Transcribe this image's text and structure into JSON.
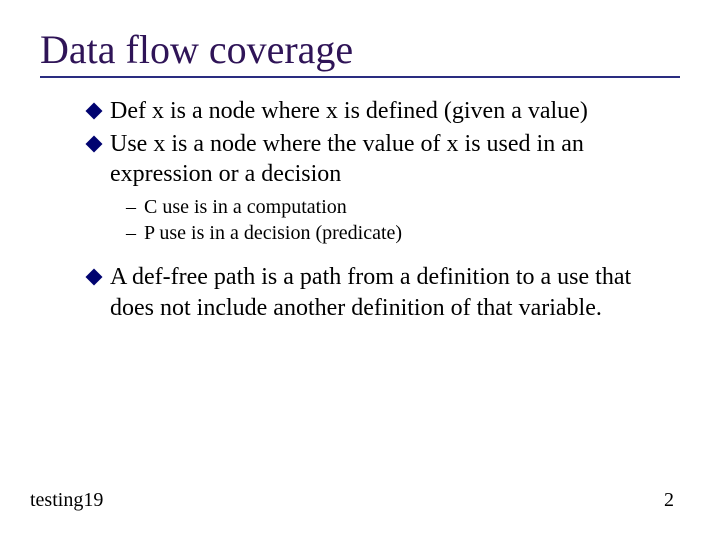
{
  "title": "Data flow coverage",
  "bullets": [
    {
      "text": "Def x is a node where x is defined (given a value)"
    },
    {
      "text": "Use x is a node where the value of x is used in an expression or a decision"
    }
  ],
  "subbullets": [
    {
      "text": "C use is in a computation"
    },
    {
      "text": "P use is in a decision (predicate)"
    }
  ],
  "bullets2": [
    {
      "text": "A def-free path is a path from a definition to a use that does not include another definition of that variable."
    }
  ],
  "footer": {
    "left": "testing19",
    "right": "2"
  }
}
